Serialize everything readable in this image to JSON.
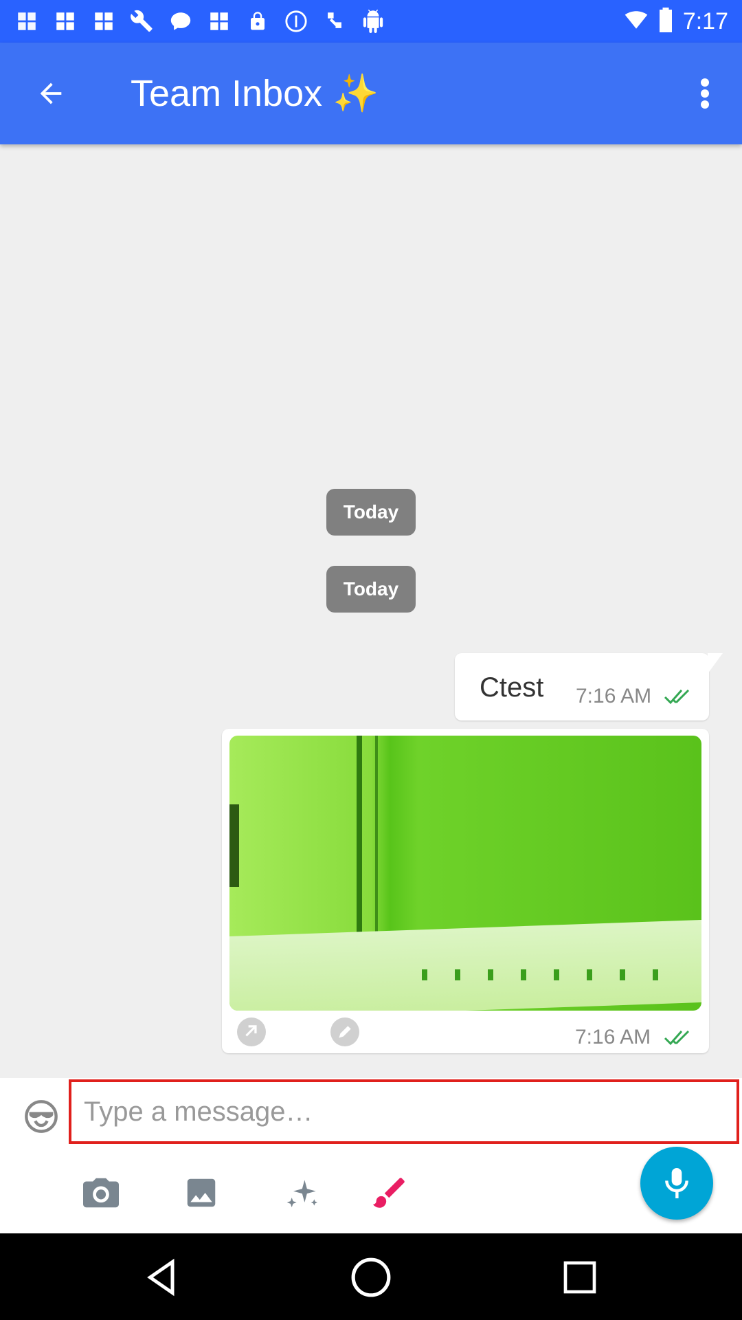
{
  "status_bar": {
    "time": "7:17",
    "icons": [
      "app-notification-icon",
      "app-notification-icon",
      "app-notification-icon",
      "wrench-icon",
      "chat-bubble-icon",
      "app-notification-icon",
      "lock-icon",
      "info-icon",
      "satellite-icon",
      "android-icon"
    ],
    "right_icons": [
      "wifi-icon",
      "battery-icon"
    ]
  },
  "app_bar": {
    "title": "Team Inbox ✨",
    "color": "#3d72f5"
  },
  "chat": {
    "date_chips": [
      "Today",
      "Today"
    ],
    "messages": [
      {
        "type": "text",
        "text": "Ctest",
        "time": "7:16 AM",
        "status": "read"
      },
      {
        "type": "image",
        "time": "7:16 AM",
        "status": "read"
      }
    ]
  },
  "composer": {
    "placeholder": "Type a message…",
    "value": "",
    "tools": [
      "camera-icon",
      "gallery-icon",
      "sparkles-icon",
      "brush-icon"
    ],
    "mic_color": "#00a5d6"
  },
  "nav": [
    "back-icon",
    "home-icon",
    "recents-icon"
  ]
}
